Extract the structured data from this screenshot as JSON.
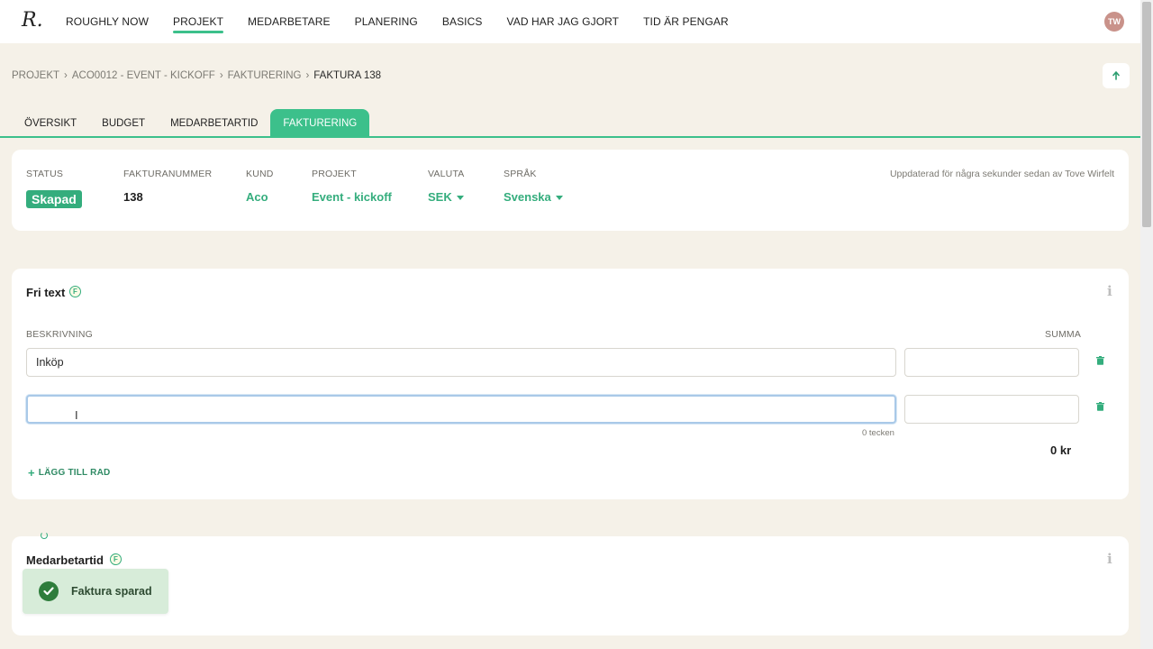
{
  "nav": {
    "logo": "R.",
    "items": [
      {
        "label": "ROUGHLY NOW"
      },
      {
        "label": "PROJEKT"
      },
      {
        "label": "MEDARBETARE"
      },
      {
        "label": "PLANERING"
      },
      {
        "label": "BASICS"
      },
      {
        "label": "VAD HAR JAG GJORT"
      },
      {
        "label": "TID ÄR PENGAR"
      }
    ],
    "active": "PROJEKT",
    "avatar_initials": "TW"
  },
  "breadcrumb": {
    "items": [
      "PROJEKT",
      "ACO0012 - EVENT - KICKOFF",
      "FAKTURERING"
    ],
    "current": "FAKTURA 138",
    "separator": "›"
  },
  "tabs": [
    {
      "label": "ÖVERSIKT"
    },
    {
      "label": "BUDGET"
    },
    {
      "label": "MEDARBETARTID"
    },
    {
      "label": "FAKTURERING"
    }
  ],
  "invoice": {
    "status_label": "STATUS",
    "status_value": "Skapad",
    "number_label": "FAKTURANUMMER",
    "number_value": "138",
    "customer_label": "KUND",
    "customer_value": "Aco",
    "project_label": "PROJEKT",
    "project_value": "Event - kickoff",
    "currency_label": "VALUTA",
    "currency_value": "SEK",
    "language_label": "SPRÅK",
    "language_value": "Svenska",
    "updated_text": "Uppdaterad för några sekunder sedan av Tove Wirfelt"
  },
  "fri_text": {
    "title": "Fri text",
    "badge": "F",
    "description_label": "BESKRIVNING",
    "sum_label": "SUMMA",
    "rows": [
      {
        "description": "Inköp",
        "sum": ""
      },
      {
        "description": "",
        "sum": ""
      }
    ],
    "char_count": "0 tecken",
    "total": "0 kr",
    "add_row_label": "LÄGG TILL RAD"
  },
  "medarbetartid": {
    "title": "Medarbetartid",
    "badge": "F"
  },
  "toast": {
    "message": "Faktura sparad"
  },
  "colors": {
    "accent": "#3cc08b",
    "background": "#f5f1e8",
    "toast_bg": "#d7ecd9"
  }
}
